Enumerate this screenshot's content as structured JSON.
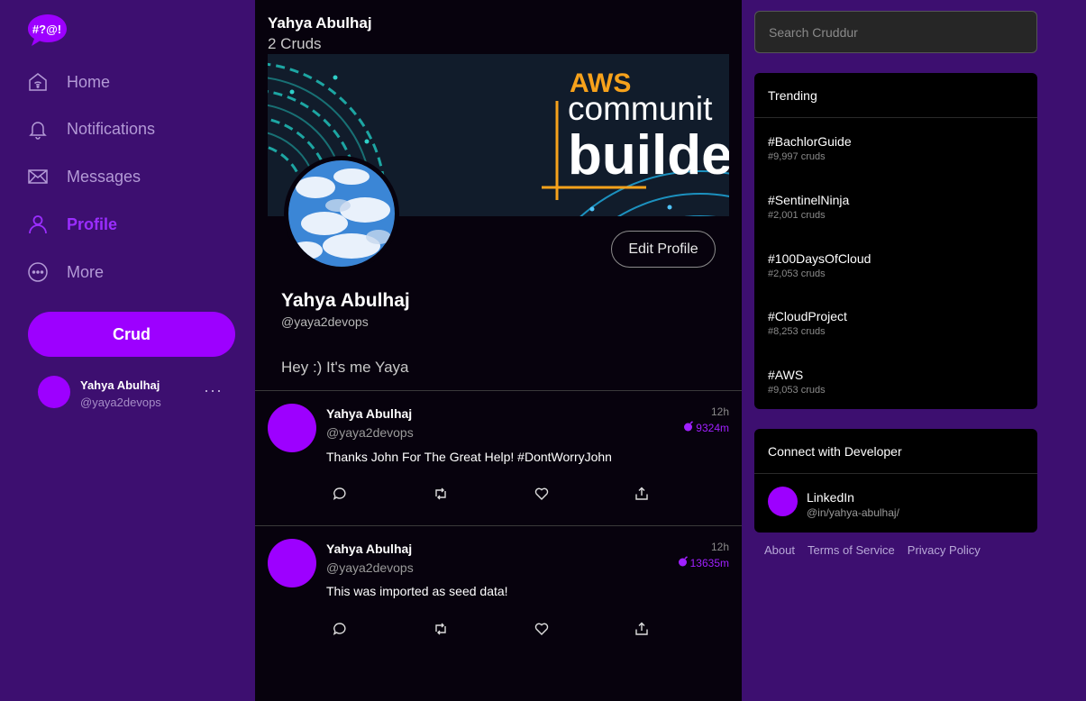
{
  "brand": {
    "logo_text": "#?@!"
  },
  "nav": {
    "items": [
      {
        "label": "Home",
        "icon": "home-icon"
      },
      {
        "label": "Notifications",
        "icon": "bell-icon"
      },
      {
        "label": "Messages",
        "icon": "envelope-icon"
      },
      {
        "label": "Profile",
        "icon": "person-icon",
        "active": true
      },
      {
        "label": "More",
        "icon": "more-circle-icon"
      }
    ],
    "crud_label": "Crud"
  },
  "current_user": {
    "name": "Yahya Abulhaj",
    "handle": "@yaya2devops",
    "menu": "···"
  },
  "profile": {
    "header_name": "Yahya Abulhaj",
    "header_count": "2 Cruds",
    "banner": {
      "line1": "AWS",
      "line2": "communit",
      "line3": "builde"
    },
    "edit_label": "Edit Profile",
    "name": "Yahya Abulhaj",
    "handle": "@yaya2devops",
    "bio": "Hey :) It's me Yaya"
  },
  "posts": [
    {
      "name": "Yahya Abulhaj",
      "handle": "@yaya2devops",
      "message": "Thanks John For The Great Help! #DontWorryJohn",
      "time": "12h",
      "expires": "9324m"
    },
    {
      "name": "Yahya Abulhaj",
      "handle": "@yaya2devops",
      "message": "This was imported as seed data!",
      "time": "12h",
      "expires": "13635m"
    }
  ],
  "search": {
    "placeholder": "Search Cruddur"
  },
  "trending": {
    "title": "Trending",
    "items": [
      {
        "tag": "#BachlorGuide",
        "count": "#9,997 cruds"
      },
      {
        "tag": "#SentinelNinja",
        "count": "#2,001 cruds"
      },
      {
        "tag": "#100DaysOfCloud",
        "count": "#2,053 cruds"
      },
      {
        "tag": "#CloudProject",
        "count": "#8,253 cruds"
      },
      {
        "tag": "#AWS",
        "count": "#9,053 cruds"
      }
    ]
  },
  "connect": {
    "title": "Connect with Developer",
    "name": "LinkedIn",
    "handle": "@in/yahya-abulhaj/"
  },
  "footer": {
    "about": "About",
    "terms": "Terms of Service",
    "privacy": "Privacy Policy"
  },
  "colors": {
    "accent": "#9d00ff",
    "sidebar_bg": "#3d0f70",
    "feed_bg": "#07020d",
    "card_bg": "#000000"
  }
}
